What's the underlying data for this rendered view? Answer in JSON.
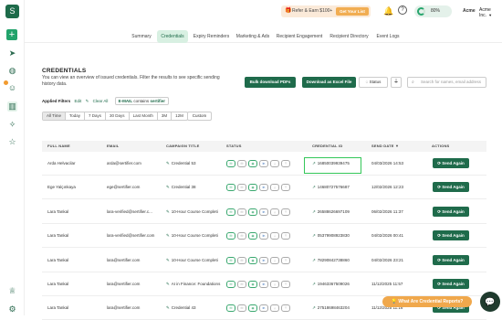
{
  "colors": {
    "brand": "#1f6b4b",
    "accent": "#f1ad52",
    "highlight": "#34c759"
  },
  "sidebar": {
    "icons": [
      "logo-icon",
      "plus-icon",
      "send-icon",
      "globe-icon",
      "users-icon",
      "analytics-icon",
      "integrations-icon",
      "star-icon",
      "trophy-icon",
      "settings-icon"
    ]
  },
  "topbar": {
    "referral_text": "Refer & Earn $100+",
    "referral_button": "Get Your List",
    "progress": "80%",
    "progress_value": 0.8,
    "account_logo": "Acme",
    "account_name": "Acme Inc."
  },
  "tabs": [
    "Summary",
    "Credentials",
    "Expiry Reminders",
    "Marketing & Ads",
    "Recipient Engagement",
    "Recipient Directory",
    "Event Logs"
  ],
  "active_tab": "Credentials",
  "page": {
    "title": "CREDENTIALS",
    "subtitle": "You can view an overview of issued credentials. Filter the results to see specific sending history data."
  },
  "actions": {
    "bulk_download": "Bulk download PDFs",
    "download_excel": "Download as Excel File",
    "status": "Status",
    "search_placeholder": "Search for names, email address"
  },
  "filters": {
    "label": "Applied Filters",
    "edit": "Edit",
    "clear_all": "Clear All",
    "field": "E-MAIL",
    "operator": "contains",
    "value": "sertifier"
  },
  "ranges": [
    "All Time",
    "Today",
    "7 Days",
    "30 Days",
    "Last Month",
    "3M",
    "12M"
  ],
  "custom": "Custom",
  "table": {
    "headers": [
      "FULL NAME",
      "EMAIL",
      "CAMPAIGN TITLE",
      "STATUS",
      "CREDENTIAL ID",
      "SEND DATE",
      "ACTIONS"
    ],
    "send_label": "Send Again",
    "rows": [
      {
        "name": "Arda Helvacilar",
        "email": "arda@sertifier.com",
        "campaign": "Credential 53",
        "id": "16850039939475",
        "date": "04/03/2026 14:53"
      },
      {
        "name": "Ege Yalçınkaya",
        "email": "ege@sertifier.com",
        "campaign": "Credential 38",
        "id": "14680727576687",
        "date": "12/02/2026 12:23"
      },
      {
        "name": "Lara Tankal",
        "email": "lara-verified@sertifier.c...",
        "campaign": "10-Hour Course Completi",
        "id": "26588626697109",
        "date": "06/02/2026 11:37"
      },
      {
        "name": "Lara Tankal",
        "email": "lara-verified@sertifier.com",
        "campaign": "10-Hour Course Completi",
        "id": "05379908923830",
        "date": "04/02/2026 00:41"
      },
      {
        "name": "Lara Tankal",
        "email": "lara@sertifier.com",
        "campaign": "10-Hour Course Completi",
        "id": "78290842738860",
        "date": "04/02/2026 23:21"
      },
      {
        "name": "Lara Tankal",
        "email": "lara@sertifier.com",
        "campaign": "AI in Finance: Foundations",
        "id": "19463367509026",
        "date": "11/12/2025 11:57"
      },
      {
        "name": "Lara Tankal",
        "email": "lara@sertifier.com",
        "campaign": "Credential 43",
        "id": "27518698463204",
        "date": "11/12/2025 11:16"
      }
    ]
  },
  "cta": "What Are Credential Reports?"
}
